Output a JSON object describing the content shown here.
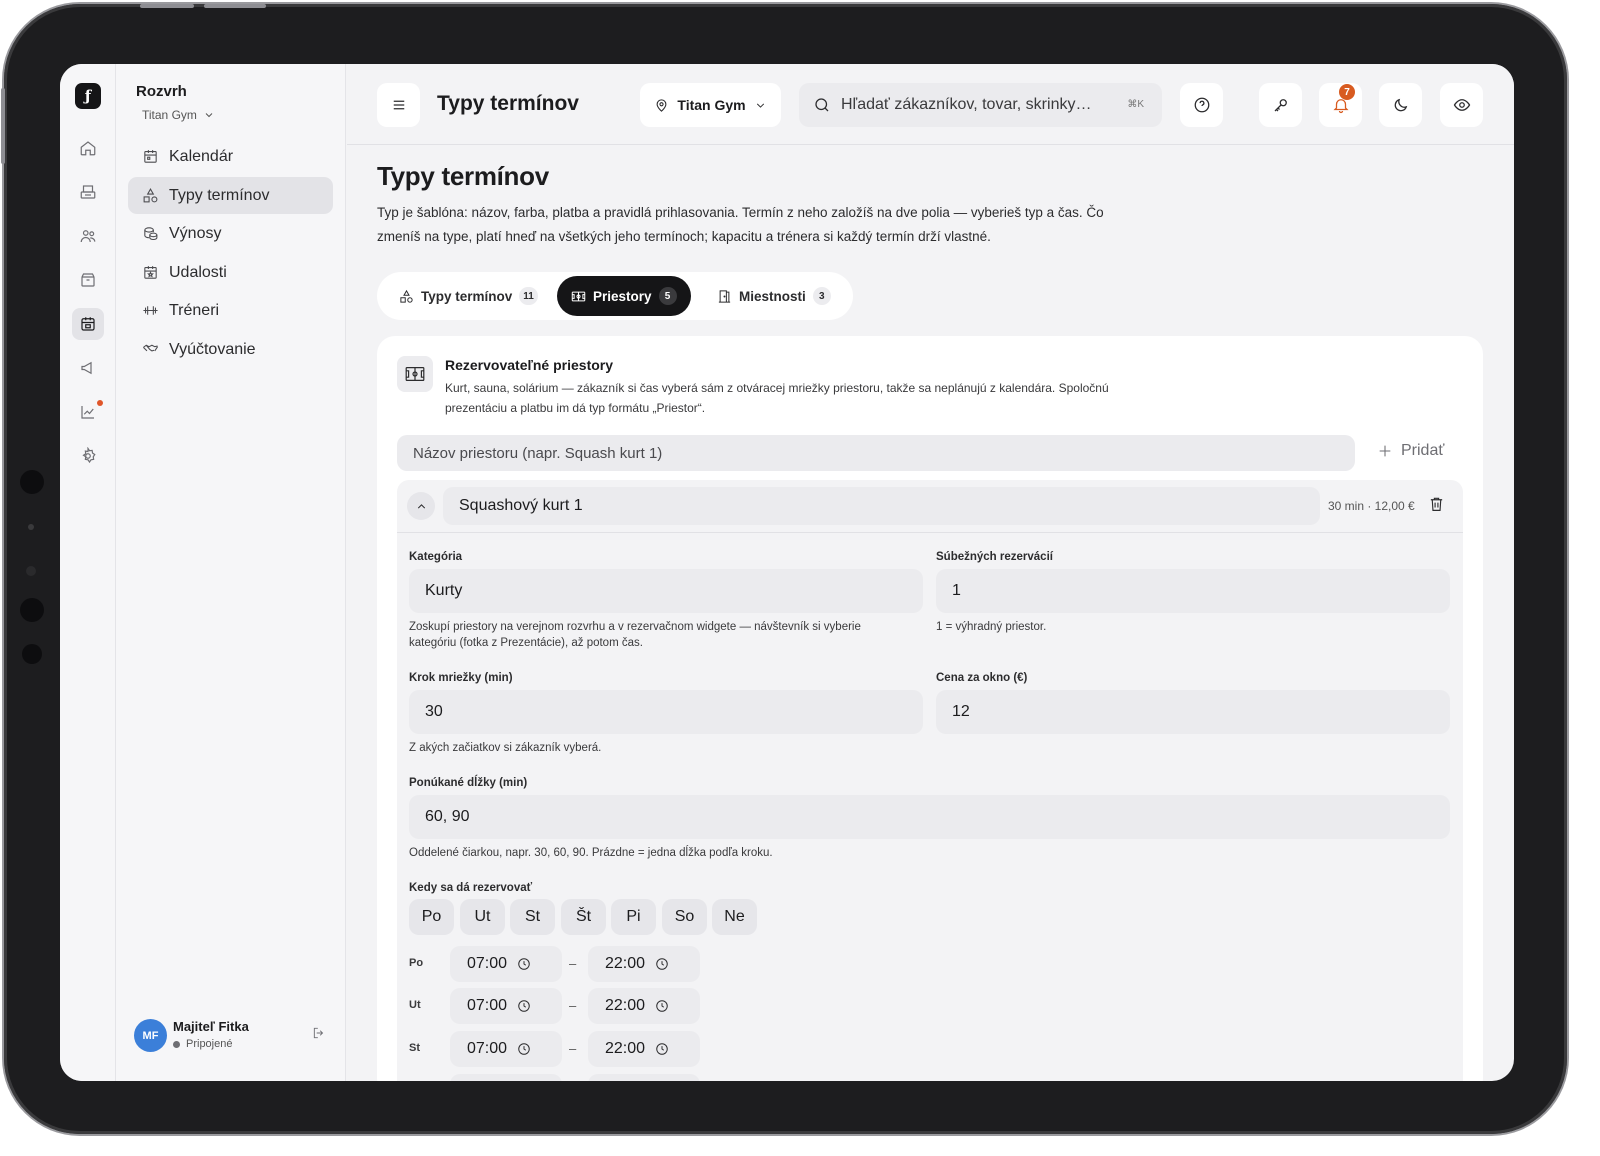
{
  "rail": {
    "logo": "ƒ",
    "icons": [
      "home-icon",
      "register-icon",
      "users-icon",
      "box-icon",
      "calendar-icon",
      "megaphone-icon",
      "chart-icon",
      "settings-icon"
    ]
  },
  "sidebar": {
    "title": "Rozvrh",
    "gym": "Titan Gym",
    "items": [
      {
        "label": "Kalendár"
      },
      {
        "label": "Typy termínov"
      },
      {
        "label": "Výnosy"
      },
      {
        "label": "Udalosti"
      },
      {
        "label": "Tréneri"
      },
      {
        "label": "Vyúčtovanie"
      }
    ],
    "user": {
      "initials": "MF",
      "name": "Majiteľ Fitka",
      "status": "Pripojené"
    }
  },
  "topbar": {
    "title": "Typy termínov",
    "location": "Titan Gym",
    "search_placeholder": "Hľadať zákazníkov, tovar, skrinky…",
    "shortcut": "⌘K",
    "notifications_count": "7"
  },
  "page": {
    "title": "Typy termínov",
    "intro": "Typ je šablóna: názov, farba, platba a pravidlá prihlasovania. Termín z neho založíš na dve polia — vyberieš typ a čas. Čo zmeníš na type, platí hneď na všetkých jeho termínoch; kapacitu a trénera si každý termín drží vlastné."
  },
  "tabs": [
    {
      "label": "Typy termínov",
      "count": "11"
    },
    {
      "label": "Priestory",
      "count": "5"
    },
    {
      "label": "Miestnosti",
      "count": "3"
    }
  ],
  "card": {
    "title": "Rezervovateľné priestory",
    "description": "Kurt, sauna, solárium — zákazník si čas vyberá sám z otváracej mriežky priestoru, takže sa neplánujú z kalendára. Spoločnú prezentáciu a platbu im dá typ formátu „Priestor“.",
    "name_placeholder": "Názov priestoru (napr. Squash kurt 1)",
    "add_label": "Pridať"
  },
  "space": {
    "name": "Squashový kurt 1",
    "meta": "30 min · 12,00 €",
    "category_label": "Kategória",
    "category_value": "Kurty",
    "category_hint": "Zoskupí priestory na verejnom rozvrhu a v rezervačnom widgete — návštevník si vyberie kategóriu (fotka z Prezentácie), až potom čas.",
    "concurrent_label": "Súbežných rezervácií",
    "concurrent_value": "1",
    "concurrent_hint": "1 = výhradný priestor.",
    "step_label": "Krok mriežky (min)",
    "step_value": "30",
    "step_hint": "Z akých začiatkov si zákazník vyberá.",
    "price_label": "Cena za okno (€)",
    "price_value": "12",
    "lengths_label": "Ponúkané dĺžky (min)",
    "lengths_value": "60, 90",
    "lengths_hint": "Oddelené čiarkou, napr. 30, 60, 90. Prázdne = jedna dĺžka podľa kroku.",
    "schedule_label": "Kedy sa dá rezervovať",
    "days": [
      "Po",
      "Ut",
      "St",
      "Št",
      "Pi",
      "So",
      "Ne"
    ],
    "hours": [
      {
        "day": "Po",
        "from": "07:00",
        "to": "22:00"
      },
      {
        "day": "Ut",
        "from": "07:00",
        "to": "22:00"
      },
      {
        "day": "St",
        "from": "07:00",
        "to": "22:00"
      }
    ],
    "separator": "–"
  },
  "colors": {
    "accent_dark": "#151517",
    "badge": "#d85b20",
    "avatar": "#3b7fd9"
  }
}
